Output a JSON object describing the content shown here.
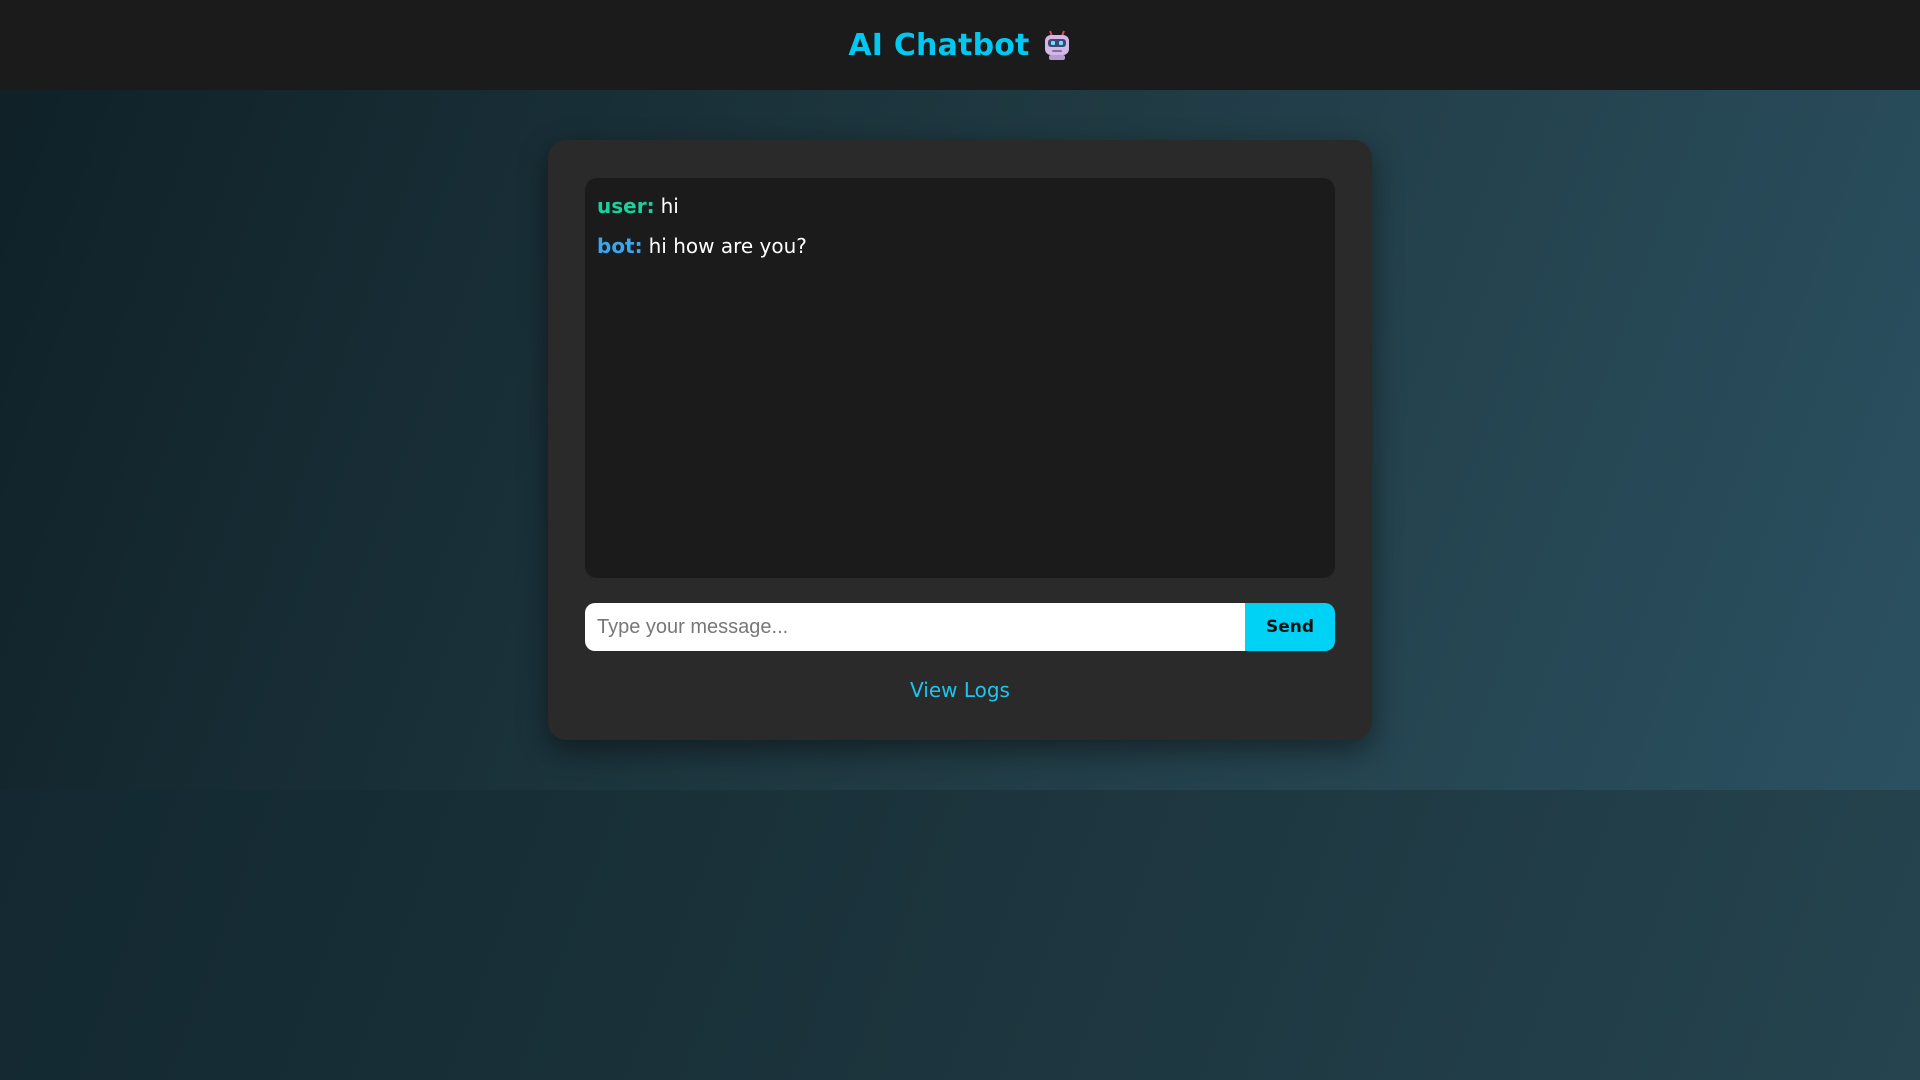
{
  "header": {
    "title": "AI Chatbot",
    "icon": "robot-icon",
    "title_color": "#00c8f0"
  },
  "chat": {
    "messages": [
      {
        "sender": "user:",
        "text": "hi"
      },
      {
        "sender": "bot:",
        "text": "hi how are you?"
      }
    ]
  },
  "input": {
    "placeholder": "Type your message...",
    "value": ""
  },
  "send_button": {
    "label": "Send"
  },
  "logs_link": {
    "label": "View Logs"
  },
  "colors": {
    "accent": "#00d2f5",
    "user_label": "#1dcf9a",
    "bot_label": "#3aa6f0",
    "card_bg": "#2a2a2a",
    "chat_bg": "#1b1b1b",
    "header_bg": "#1b1b1b"
  }
}
